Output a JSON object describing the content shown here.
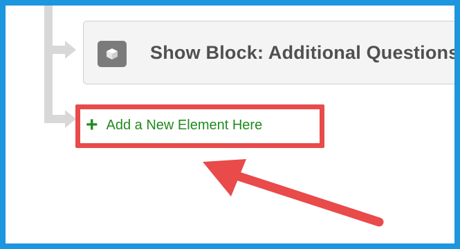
{
  "block": {
    "title": "Show Block: Additional Questions",
    "icon": "cube-icon"
  },
  "add_element": {
    "icon": "plus-icon",
    "plus_symbol": "+",
    "label": "Add a New Element Here"
  },
  "colors": {
    "frame_border": "#1c96de",
    "highlight": "#e94a4a",
    "add_link": "#1f8a1f",
    "block_icon_bg": "#7b7b7b",
    "connector": "#d8d8d8"
  }
}
